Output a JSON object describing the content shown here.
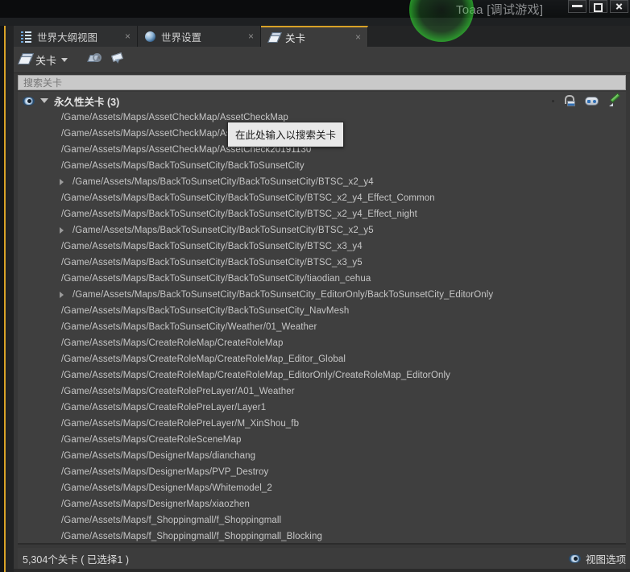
{
  "window": {
    "title": "Toaa [调试游戏]",
    "controls": [
      "minimize-button",
      "maximize-button",
      "close-button"
    ]
  },
  "overlay": {
    "click_ring_color": "#32dc32"
  },
  "tabs": [
    {
      "label": "世界大纲视图",
      "icon": "outliner-icon",
      "active": false,
      "close": "×"
    },
    {
      "label": "世界设置",
      "icon": "globe-icon",
      "active": false,
      "close": "×"
    },
    {
      "label": "关卡",
      "icon": "levels-icon",
      "active": true,
      "close": "×"
    }
  ],
  "toolbar": {
    "levels_label": "关卡",
    "levels_icon": "levels-icon",
    "caret_icon": "chevron-down-icon",
    "buttons": [
      {
        "name": "level-search-button",
        "icon": "level-search-icon"
      },
      {
        "name": "level-paint-button",
        "icon": "paintbrush-icon"
      }
    ]
  },
  "search": {
    "placeholder": "搜索关卡",
    "value": ""
  },
  "tooltip": {
    "text": "在此处输入以搜索关卡"
  },
  "group": {
    "title": "永久性关卡 (3)",
    "eye_icon": "eye-icon",
    "collapse_icon": "triangle-down-icon",
    "right_icons": [
      {
        "name": "lock-icon",
        "glyph": "unlocked-padlock"
      },
      {
        "name": "gamepad-icon",
        "glyph": "gamepad"
      },
      {
        "name": "pencil-icon",
        "glyph": "green-pencil"
      }
    ]
  },
  "levels": [
    {
      "path": "/Game/Assets/Maps/AssetCheckMap/AssetCheckMap",
      "expandable": false
    },
    {
      "path": "/Game/Assets/Maps/AssetCheckMap/AssetCheck20190926",
      "expandable": false
    },
    {
      "path": "/Game/Assets/Maps/AssetCheckMap/AssetCheck20191130",
      "expandable": false
    },
    {
      "path": "/Game/Assets/Maps/BackToSunsetCity/BackToSunsetCity",
      "expandable": false
    },
    {
      "path": "/Game/Assets/Maps/BackToSunsetCity/BackToSunsetCity/BTSC_x2_y4",
      "expandable": true
    },
    {
      "path": "/Game/Assets/Maps/BackToSunsetCity/BackToSunsetCity/BTSC_x2_y4_Effect_Common",
      "expandable": false
    },
    {
      "path": "/Game/Assets/Maps/BackToSunsetCity/BackToSunsetCity/BTSC_x2_y4_Effect_night",
      "expandable": false
    },
    {
      "path": "/Game/Assets/Maps/BackToSunsetCity/BackToSunsetCity/BTSC_x2_y5",
      "expandable": true
    },
    {
      "path": "/Game/Assets/Maps/BackToSunsetCity/BackToSunsetCity/BTSC_x3_y4",
      "expandable": false
    },
    {
      "path": "/Game/Assets/Maps/BackToSunsetCity/BackToSunsetCity/BTSC_x3_y5",
      "expandable": false
    },
    {
      "path": "/Game/Assets/Maps/BackToSunsetCity/BackToSunsetCity/tiaodian_cehua",
      "expandable": false
    },
    {
      "path": "/Game/Assets/Maps/BackToSunsetCity/BackToSunsetCity_EditorOnly/BackToSunsetCity_EditorOnly",
      "expandable": true
    },
    {
      "path": "/Game/Assets/Maps/BackToSunsetCity/BackToSunsetCity_NavMesh",
      "expandable": false
    },
    {
      "path": "/Game/Assets/Maps/BackToSunsetCity/Weather/01_Weather",
      "expandable": false
    },
    {
      "path": "/Game/Assets/Maps/CreateRoleMap/CreateRoleMap",
      "expandable": false
    },
    {
      "path": "/Game/Assets/Maps/CreateRoleMap/CreateRoleMap_Editor_Global",
      "expandable": false
    },
    {
      "path": "/Game/Assets/Maps/CreateRoleMap/CreateRoleMap_EditorOnly/CreateRoleMap_EditorOnly",
      "expandable": false
    },
    {
      "path": "/Game/Assets/Maps/CreateRolePreLayer/A01_Weather",
      "expandable": false
    },
    {
      "path": "/Game/Assets/Maps/CreateRolePreLayer/Layer1",
      "expandable": false
    },
    {
      "path": "/Game/Assets/Maps/CreateRolePreLayer/M_XinShou_fb",
      "expandable": false
    },
    {
      "path": "/Game/Assets/Maps/CreateRoleSceneMap",
      "expandable": false
    },
    {
      "path": "/Game/Assets/Maps/DesignerMaps/dianchang",
      "expandable": false
    },
    {
      "path": "/Game/Assets/Maps/DesignerMaps/PVP_Destroy",
      "expandable": false
    },
    {
      "path": "/Game/Assets/Maps/DesignerMaps/Whitemodel_2",
      "expandable": false
    },
    {
      "path": "/Game/Assets/Maps/DesignerMaps/xiaozhen",
      "expandable": false
    },
    {
      "path": "/Game/Assets/Maps/f_Shoppingmall/f_Shoppingmall",
      "expandable": false
    },
    {
      "path": "/Game/Assets/Maps/f_Shoppingmall/f_Shoppingmall_Blocking",
      "expandable": false
    }
  ],
  "status": {
    "count_text": "5,304个关卡 ( 已选择1 )",
    "view_options_label": "视图选项",
    "view_options_icon": "eye-icon"
  }
}
